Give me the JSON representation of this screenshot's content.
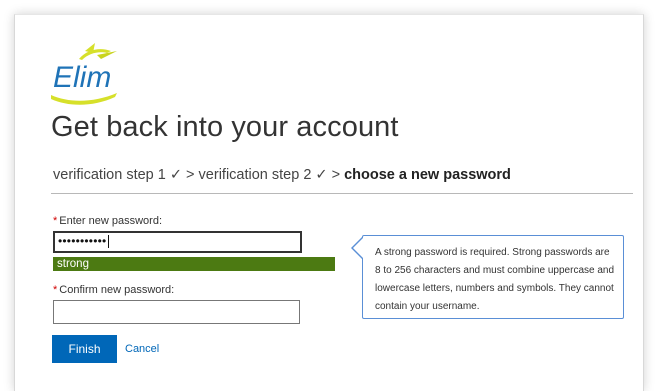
{
  "brand": {
    "logo_text": "Elim",
    "colors": {
      "logo_blue": "#1f73b7",
      "logo_yellow": "#d6e02a"
    }
  },
  "page": {
    "title": "Get back into your account"
  },
  "breadcrumb": {
    "step1": "verification step 1 ✓",
    "sep1": " > ",
    "step2": "verification step 2 ✓",
    "sep2": " > ",
    "current": "choose a new password"
  },
  "form": {
    "required_marker": "*",
    "new_password_label": "Enter new password:",
    "new_password_value": "•••••••••••",
    "strength_label": "strong",
    "confirm_password_label": "Confirm new password:",
    "confirm_password_value": ""
  },
  "tooltip": {
    "text": "A strong password is required. Strong passwords are 8 to 256 characters and must combine uppercase and lowercase letters, numbers and symbols. They cannot contain your username."
  },
  "actions": {
    "finish_label": "Finish",
    "cancel_label": "Cancel"
  },
  "colors": {
    "primary": "#0067b8",
    "strength_strong": "#4c7a12",
    "tooltip_border": "#5a8fd6",
    "required": "#d00000"
  }
}
